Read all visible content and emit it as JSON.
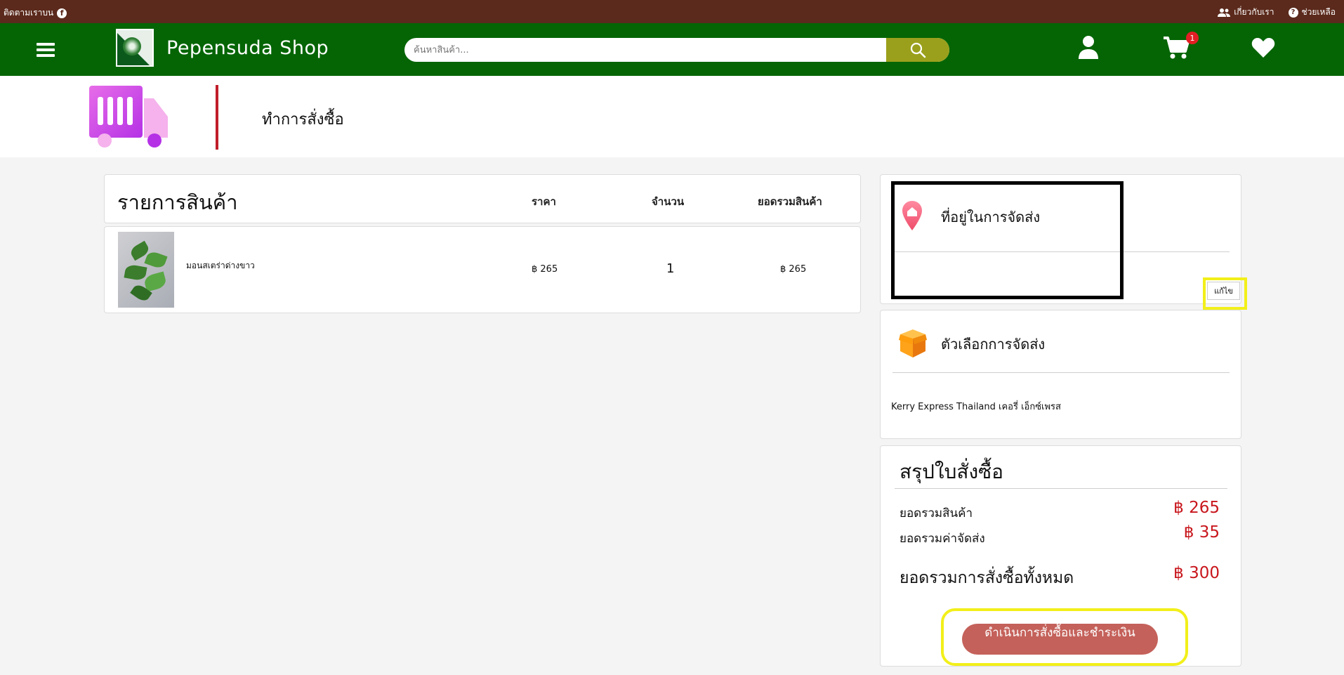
{
  "topbar": {
    "follow_label": "ติดตามเราบน",
    "about_label": "เกี่ยวกับเรา",
    "help_label": "ช่วยเหลือ"
  },
  "navbar": {
    "brand": "Pepensuda Shop",
    "search_placeholder": "ค้นหาสินค้า...",
    "cart_count": "1"
  },
  "page": {
    "title": "ทำการสั่งซื้อ"
  },
  "items": {
    "heading": "รายการสินค้า",
    "columns": [
      "ราคา",
      "จำนวน",
      "ยอดรวมสินค้า"
    ],
    "rows": [
      {
        "name": "มอนสเตร่าด่างขาว",
        "price": "฿ 265",
        "qty": "1",
        "subtotal": "฿ 265"
      }
    ]
  },
  "address": {
    "label": "ที่อยู่ในการจัดส่ง",
    "edit_label": "แก้ไข"
  },
  "shipping": {
    "label": "ตัวเลือกการจัดส่ง",
    "carrier": "Kerry Express Thailand เคอรี่ เอ็กซ์เพรส"
  },
  "summary": {
    "title": "สรุปใบสั่งซื้อ",
    "products_label": "ยอดรวมสินค้า",
    "products_amount": "฿ 265",
    "shipping_label": "ยอดรวมค่าจัดส่ง",
    "shipping_amount": "฿ 35",
    "total_label": "ยอดรวมการสั่งซื้อทั้งหมด",
    "total_amount": "฿ 300",
    "checkout_label": "ดำเนินการสั่งซื้อและชำระเงิน"
  },
  "colors": {
    "topbar": "#5b2a1c",
    "navbar": "#056505",
    "search_button": "#9aa01b",
    "accent_red": "#c8171d",
    "checkout_button": "#c4615a",
    "highlight": "#f2ef1a"
  }
}
